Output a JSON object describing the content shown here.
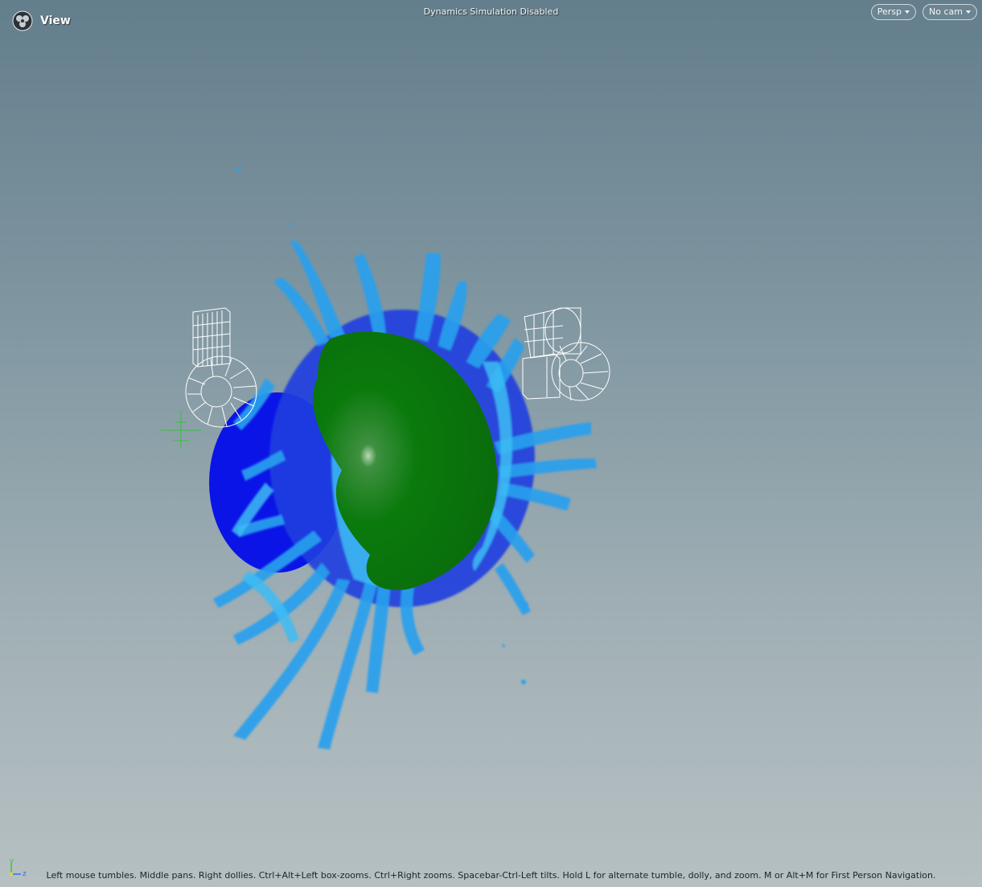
{
  "viewport": {
    "title": "View",
    "status": "Dynamics Simulation Disabled",
    "projection_menu": "Persp",
    "camera_menu": "No cam",
    "footer_hint": "Left mouse tumbles. Middle pans. Right dollies. Ctrl+Alt+Left box-zooms. Ctrl+Right zooms. Spacebar-Ctrl-Left tilts. Hold L for alternate tumble, dolly, and zoom. M or Alt+M for First Person Navigation.",
    "axis_labels": {
      "y": "y",
      "z": "z"
    },
    "icons": {
      "view": "viewport-icon",
      "projection_caret": "chevron-down-icon",
      "camera_caret": "chevron-down-icon"
    }
  },
  "scene": {
    "objects": [
      "collider-sphere-blue",
      "collider-sphere-green",
      "fluid-splash-particles",
      "wireframe-emitter-left",
      "wireframe-emitter-right",
      "origin-crosshair"
    ],
    "colors": {
      "background_top": "#637e8c",
      "background_bottom": "#b6c0c2",
      "blue_sphere": "#0a14e6",
      "green_sphere": "#0a7a0c",
      "fluid_light": "#2aa8f0",
      "fluid_dark": "#1436d8",
      "wireframe": "#ffffff",
      "crosshair": "#34c23a"
    }
  }
}
